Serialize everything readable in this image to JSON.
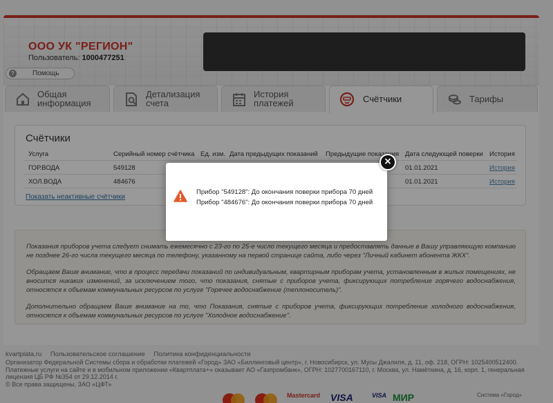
{
  "header": {
    "company": "ООО УК \"РЕГИОН\"",
    "user_label": "Пользователь:",
    "user_id": "1000477251",
    "help": "Помощь"
  },
  "tabs": [
    {
      "line1": "Общая",
      "line2": "информация",
      "icon": "house-icon"
    },
    {
      "line1": "Детализация",
      "line2": "счета",
      "icon": "document-search-icon"
    },
    {
      "line1": "История",
      "line2": "платежей",
      "icon": "calendar-icon"
    },
    {
      "line1": "Счётчики",
      "line2": "",
      "icon": "meter-icon"
    },
    {
      "line1": "Тарифы",
      "line2": "",
      "icon": "coins-icon"
    }
  ],
  "meters": {
    "title": "Счётчики",
    "columns": [
      "Услуга",
      "Серийный номер счётчика",
      "Ед. изм.",
      "Дата предыдущих показаний",
      "Предыдущие показания",
      "Дата следующей поверки",
      "История"
    ],
    "rows": [
      {
        "service": "ГОР.ВОДА",
        "serial": "549128",
        "next_check": "01.01.2021",
        "history": "История"
      },
      {
        "service": "ХОЛ.ВОДА",
        "serial": "484676",
        "next_check": "01.01.2021",
        "history": "История"
      }
    ],
    "inactive_link": "Показать неактивные счётчики"
  },
  "info": {
    "p1": "Показания приборов учета следует снимать ежемесячно с 23-го по 25-е число текущего месяца и предоставлять данные в Вашу управляющую компанию не позднее 26-го числа текущего месяца по телефону, указанному на первой странице сайта, либо через \"Личный кабинет абонента ЖКХ\".",
    "p2": "Обращаем Ваше внимание, что в процесс передачи показаний по индивидуальным, квартирным приборам учета, установленным в жилых помещениях, не вносится никаких изменений, за исключением того, что показания, снятые с приборов учета, фиксирующих потребление горячего водоснабжения, относятся к объемам коммунальных ресурсов по услуге \"Горячее водоснабжение (теплоноситель)\".",
    "p3": "Дополнительно обращаем Ваше внимание на то, что Показания, снятые с приборов учета, фиксирующих потребление холодного водоснабжения, относятся к объемам коммунальных ресурсов по услуге \"Холодное водоснабжение\"."
  },
  "footer": {
    "links": [
      "kvartplata.ru",
      "Пользовательское соглашение",
      "Политика конфиденциальности"
    ],
    "line1": "Организатор Федеральной Системы сбора и обработки платежей «Город» ЗАО «Биллинговый центр», г. Новосибирск, ул. Мусы Джалиля, д. 11, оф. 218, ОГРН: 1025400512400.",
    "line2": "Платежные услуги на сайте и в мобильном приложении «Квартплата+» оказывает АО «Газпромбанк», ОГРН: 1027700167110, г. Москва, ул. Намёткина, д. 16, корп. 1, генеральная лицензия ЦБ РФ №354 от 29.12.2014 г.",
    "line3": "© Все права защищены, ЗАО «ЦФТ»",
    "payments": [
      "Mastercard",
      "VISA",
      "VISA",
      "МИР",
      "Система «Город»"
    ]
  },
  "modal": {
    "messages": [
      "Прибор \"549128\": До окончания поверки прибора 70 дней",
      "Прибор \"484676\": До окончания поверки прибора 70 дней"
    ],
    "close": "×"
  },
  "colors": {
    "brand": "#c8352b",
    "link": "#2f6fa0",
    "warning": "#e05a2b"
  }
}
